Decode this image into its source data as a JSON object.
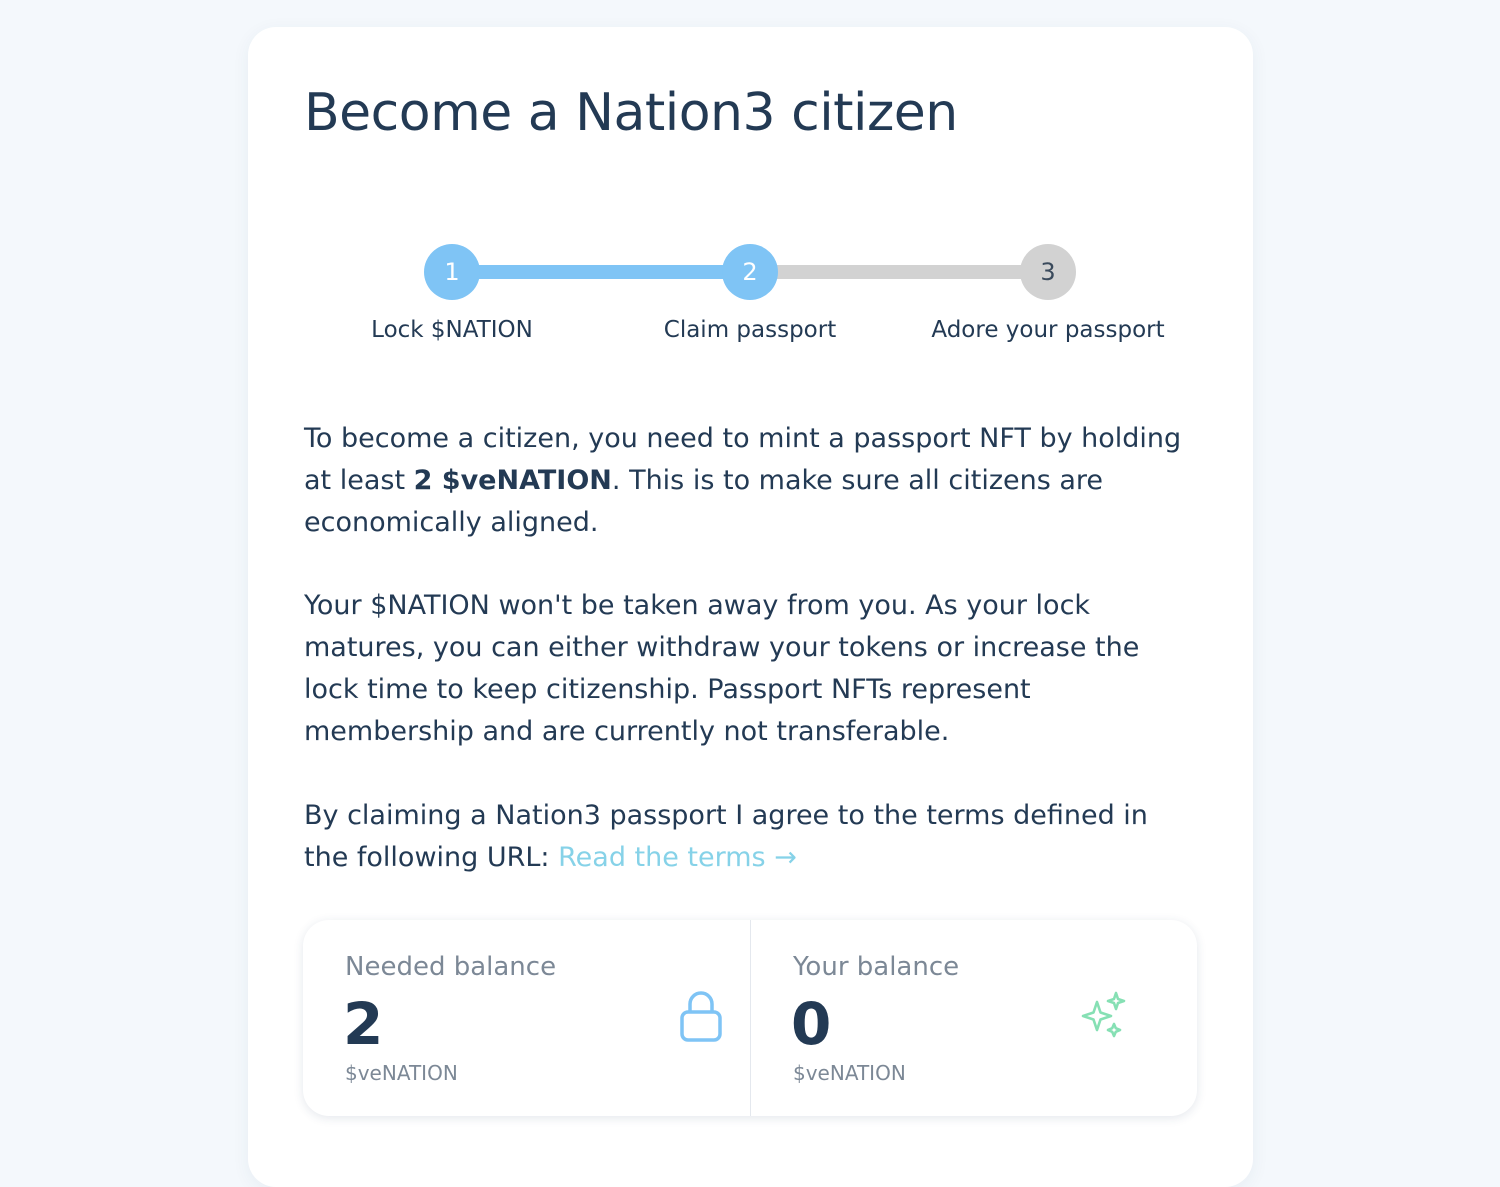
{
  "page": {
    "title": "Become a Nation3 citizen"
  },
  "stepper": {
    "steps": [
      {
        "number": "1",
        "label": "Lock $NATION",
        "state": "complete"
      },
      {
        "number": "2",
        "label": "Claim passport",
        "state": "current"
      },
      {
        "number": "3",
        "label": "Adore your passport",
        "state": "pending"
      }
    ]
  },
  "intro": {
    "p1_before": "To become a citizen, you need to mint a passport NFT by holding at least ",
    "p1_strong": "2 $veNATION",
    "p1_after": ". This is to make sure all citizens are economically aligned.",
    "p2": "Your $NATION won't be taken away from you. As your lock matures, you can either withdraw your tokens or increase the lock time to keep citizenship. Passport NFTs represent membership and are currently not transferable.",
    "p3": "By claiming a Nation3 passport I agree to the terms defined in the following URL: ",
    "terms_link": "Read the terms →"
  },
  "stats": {
    "needed": {
      "label": "Needed balance",
      "value": "2",
      "unit": "$veNATION",
      "icon": "lock-icon"
    },
    "yours": {
      "label": "Your balance",
      "value": "0",
      "unit": "$veNATION",
      "icon": "sparkles-icon"
    }
  },
  "colors": {
    "accent": "#7fc4f5",
    "pending": "#d2d2d2",
    "link": "#86d2e8",
    "sparkle": "#86e0b4",
    "text": "#233a54"
  }
}
